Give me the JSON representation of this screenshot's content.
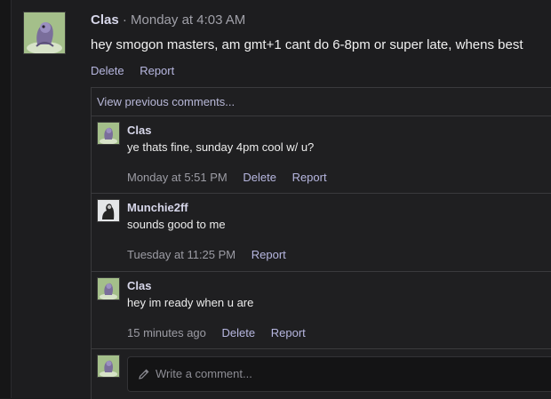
{
  "post": {
    "author": "Clas",
    "separator": "·",
    "timestamp": "Monday at 4:03 AM",
    "body": "hey smogon masters, am gmt+1 cant do 6-8pm or super late, whens best",
    "actions": {
      "delete": "Delete",
      "report": "Report"
    }
  },
  "comments": {
    "view_previous": "View previous comments...",
    "items": [
      {
        "author": "Clas",
        "text": "ye thats fine, sunday 4pm cool w/ u?",
        "time": "Monday at 5:51 PM",
        "delete": "Delete",
        "report": "Report"
      },
      {
        "author": "Munchie2ff",
        "text": "sounds good to me",
        "time": "Tuesday at 11:25 PM",
        "report": "Report"
      },
      {
        "author": "Clas",
        "text": "hey im ready when u are",
        "time": "15 minutes ago",
        "delete": "Delete",
        "report": "Report"
      }
    ],
    "reply_placeholder": "Write a comment..."
  },
  "icons": {
    "avatar_clas": "user-avatar",
    "avatar_munchie": "user-avatar",
    "compose": "pencil-icon"
  },
  "colors": {
    "link": "#b7b7e0",
    "author": "#d7d7ea",
    "background": "#1d1d1f"
  }
}
